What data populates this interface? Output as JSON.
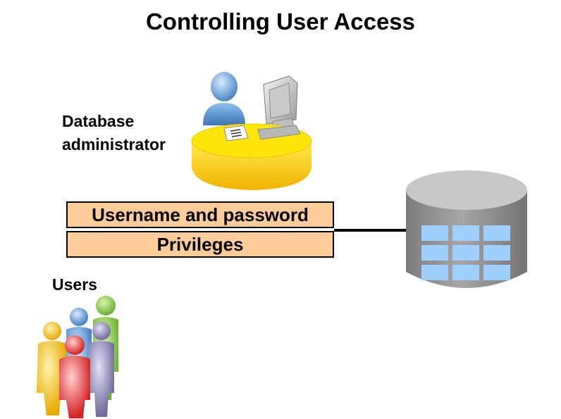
{
  "title": "Controlling User Access",
  "admin_label_line1": "Database",
  "admin_label_line2": "administrator",
  "box_username": "Username and password",
  "box_privileges": "Privileges",
  "users_label": "Users",
  "colors": {
    "box_fill": "#ffcc99",
    "desk_yellow": "#ffe000",
    "admin_blue": "#6fa8dc",
    "db_gray": "#8a8a8a",
    "db_cell": "#99ccff"
  },
  "icons": [
    "admin-desk-icon",
    "computer-monitor-icon",
    "database-icon",
    "users-group-icon"
  ]
}
